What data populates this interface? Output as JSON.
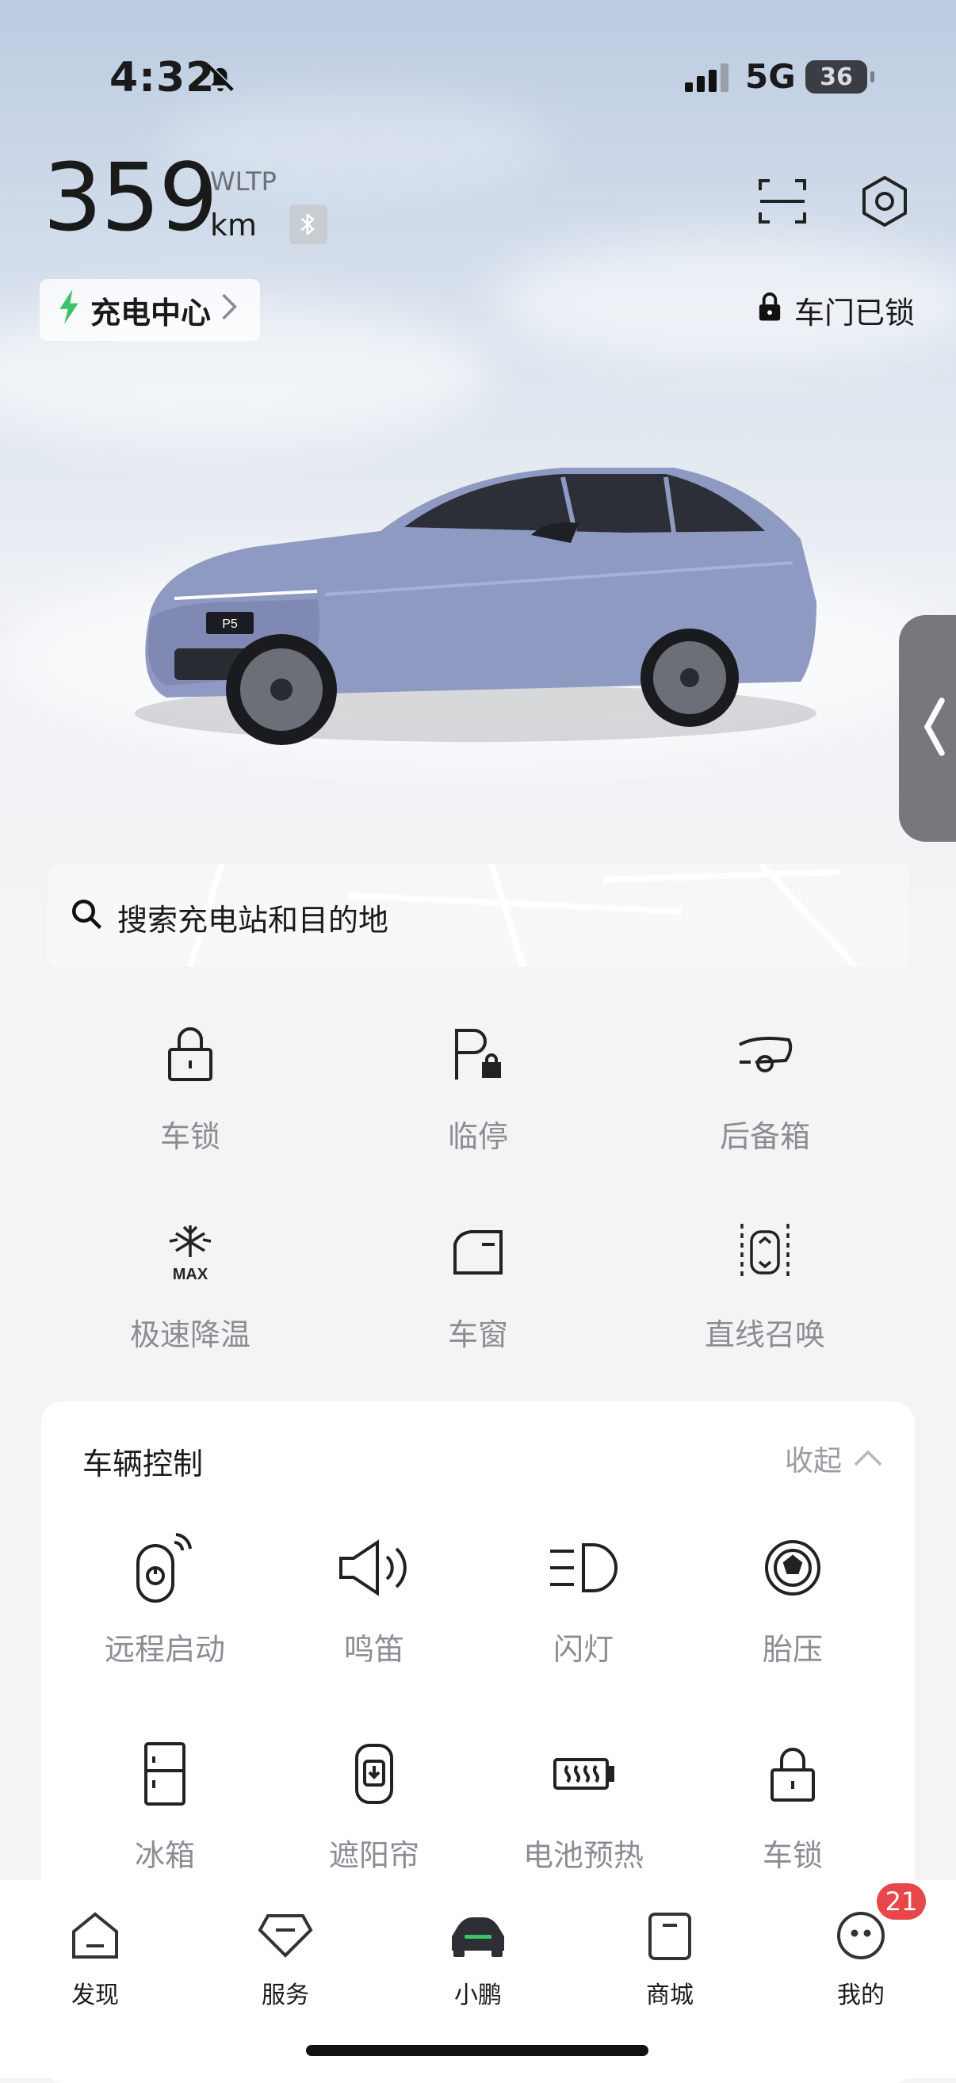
{
  "status_bar": {
    "time": "4:32",
    "network": "5G",
    "battery": "36"
  },
  "header": {
    "range_value": "359",
    "range_unit": "km",
    "range_standard": "WLTP",
    "charge_center_label": "充电中心",
    "lock_status": "车门已锁"
  },
  "car": {
    "plate": "P5",
    "color": "#8f9ac2"
  },
  "search": {
    "placeholder": "搜索充电站和目的地"
  },
  "quick_actions": [
    {
      "label": "车锁",
      "icon": "lock-icon"
    },
    {
      "label": "临停",
      "icon": "parking-lock-icon"
    },
    {
      "label": "后备箱",
      "icon": "trunk-icon"
    },
    {
      "label": "极速降温",
      "icon": "snowflake-max-icon"
    },
    {
      "label": "车窗",
      "icon": "window-icon"
    },
    {
      "label": "直线召唤",
      "icon": "summon-icon"
    }
  ],
  "vehicle_control": {
    "title": "车辆控制",
    "collapse_label": "收起",
    "items": [
      {
        "label": "远程启动",
        "icon": "remote-start-icon"
      },
      {
        "label": "鸣笛",
        "icon": "horn-icon"
      },
      {
        "label": "闪灯",
        "icon": "headlight-icon"
      },
      {
        "label": "胎压",
        "icon": "tire-pressure-icon"
      },
      {
        "label": "冰箱",
        "icon": "fridge-icon"
      },
      {
        "label": "遮阳帘",
        "icon": "sunshade-icon"
      },
      {
        "label": "电池预热",
        "icon": "battery-preheat-icon"
      },
      {
        "label": "车锁",
        "icon": "lock-icon"
      }
    ]
  },
  "tabbar": {
    "items": [
      {
        "label": "发现",
        "icon": "discover-icon"
      },
      {
        "label": "服务",
        "icon": "service-icon"
      },
      {
        "label": "小鹏",
        "icon": "car-icon",
        "active": true
      },
      {
        "label": "商城",
        "icon": "shop-icon"
      },
      {
        "label": "我的",
        "icon": "profile-icon"
      }
    ],
    "badge_count": "21"
  },
  "colors": {
    "accent_green": "#3cc26a",
    "badge_red": "#e7474a",
    "car_body": "#8f9ac2"
  }
}
